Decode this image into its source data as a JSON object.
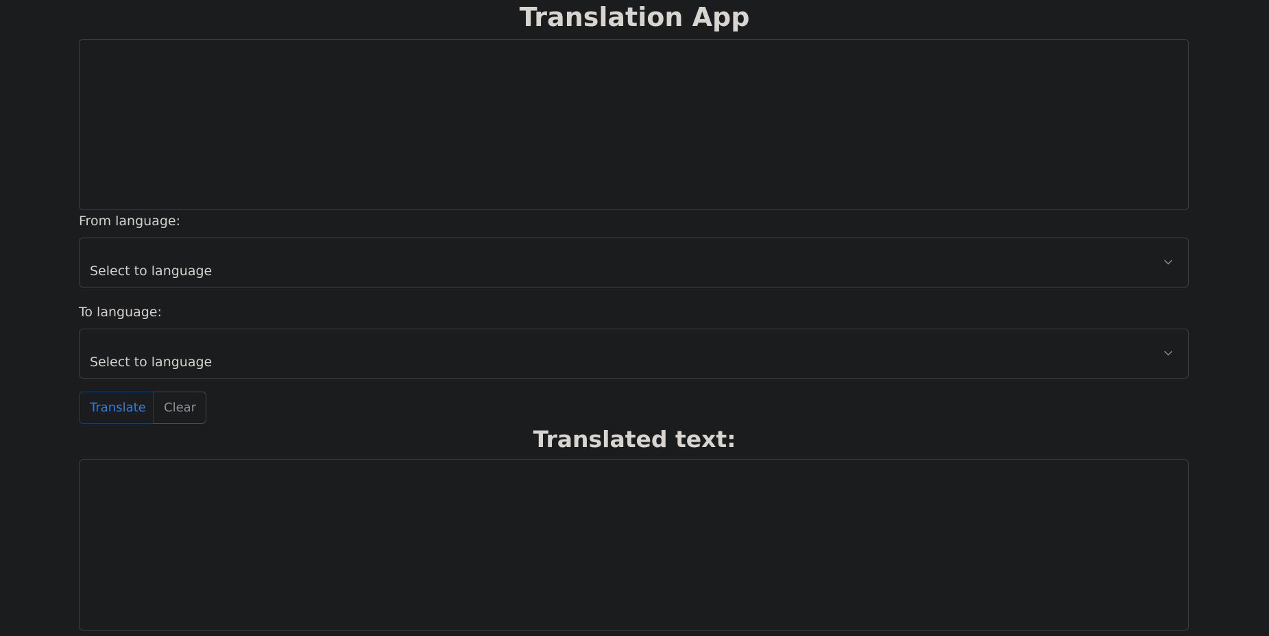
{
  "app": {
    "title": "Translation App"
  },
  "input": {
    "value": "",
    "placeholder": ""
  },
  "from_language": {
    "label": "From language:",
    "selected": "Select to language"
  },
  "to_language": {
    "label": "To language:",
    "selected": "Select to language"
  },
  "buttons": {
    "translate_label": "Translate",
    "clear_label": "Clear"
  },
  "output": {
    "heading": "Translated text:",
    "value": ""
  },
  "colors": {
    "background": "#1b1c1e",
    "text": "#d4d1cc",
    "translate_accent": "#3a7bd5",
    "border": "#3b3e42"
  },
  "icons": {
    "select_indicator": "chevron-down-icon"
  }
}
